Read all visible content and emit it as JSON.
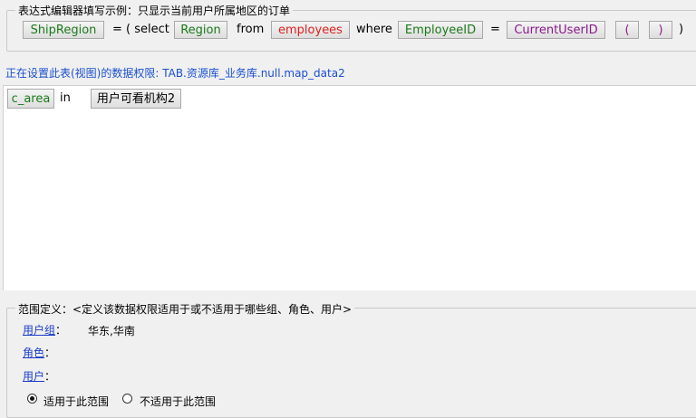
{
  "example": {
    "legend": "表达式编辑器填写示例：只显示当前用户所属地区的订单",
    "ship_region": "ShipRegion",
    "eq1": "=",
    "open_select": "( select",
    "region": "Region",
    "from": "from",
    "employees": "employees",
    "where": "where",
    "employee_id": "EmployeeID",
    "eq2": "=",
    "current_user_id": "CurrentUserID",
    "open_paren_btn": "(",
    "close_paren_btn": ")",
    "close_paren": ")"
  },
  "status": "正在设置此表(视图)的数据权限: TAB.资源库_业务库.null.map_data2",
  "expression": {
    "field": "c_area",
    "operator": "in",
    "value": "用户可看机构2"
  },
  "scope": {
    "legend": "范围定义：<定义该数据权限适用于或不适用于哪些组、角色、用户>",
    "groups_label": "用户组",
    "groups_colon": "：",
    "groups_value": "华东,华南",
    "roles_label": "角色",
    "roles_colon": "：",
    "users_label": "用户",
    "users_colon": "：",
    "apply_label": "适用于此范围",
    "not_apply_label": "不适用于此范围",
    "apply_selected": true
  }
}
